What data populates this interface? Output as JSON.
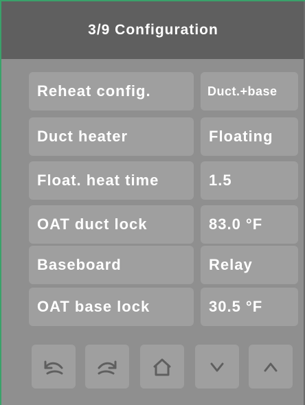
{
  "header": {
    "title": "3/9 Configuration"
  },
  "rows": [
    {
      "label": "Reheat config.",
      "value": "Duct.+base"
    },
    {
      "label": "Duct heater",
      "value": "Floating"
    },
    {
      "label": "Float. heat time",
      "value": "1.5"
    },
    {
      "label": "OAT duct lock",
      "value": "83.0 °F"
    },
    {
      "label": "Baseboard",
      "value": "Relay"
    },
    {
      "label": "OAT base lock",
      "value": "30.5 °F"
    }
  ],
  "nav": {
    "icons": [
      "undo-icon",
      "redo-icon",
      "home-icon",
      "chevron-down-icon",
      "chevron-up-icon"
    ]
  },
  "colors": {
    "background": "#8f8f8f",
    "header": "#5f5f5f",
    "button": "#9f9f9f",
    "text": "#ffffff",
    "icon": "#5f5f5f",
    "accent_border": "#3aa26a"
  }
}
